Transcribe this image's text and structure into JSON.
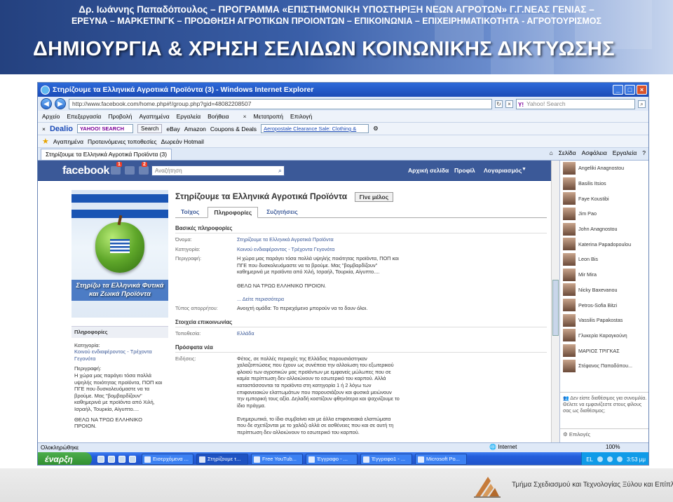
{
  "slide": {
    "header_line1": "Δρ. Ιωάννης Παπαδόπουλος – ΠΡΟΓΡΑΜΜΑ «ΕΠΙΣΤΗΜΟΝΙΚΗ ΥΠΟΣΤΗΡΙΞΗ ΝΕΩΝ ΑΓΡΟΤΩΝ» Γ.Γ.ΝΕΑΣ ΓΕΝΙΑΣ –",
    "header_line2": "ΕΡΕΥΝΑ – ΜΑΡΚΕΤΙΝΓΚ – ΠΡΟΩΘΗΣΗ ΑΓΡΟΤΙΚΩΝ ΠΡΟΙΟΝΤΩΝ – ΕΠΙΚΟΙΝΩΝΙΑ – ΕΠΙΧΕΙΡΗΜΑΤΙΚΟΤΗΤΑ - ΑΓΡΟΤΟΥΡΙΣΜΟΣ",
    "title": "ΔΗΜΙΟΥΡΓΙΑ & ΧΡΗΣΗ ΣΕΛΙΔΩΝ ΚΟΙΝΩΝΙΚΗΣ ΔΙΚΤΥΩΣΗΣ",
    "footer": "Τμήμα Σχεδιασμού και Τεχνολογίας Ξύλου και Επίπλου"
  },
  "browser": {
    "window_title": "Στηρίζουμε τα Ελληνικά Αγροτικά Προϊόντα (3) - Windows Internet Explorer",
    "url": "http://www.facebook.com/home.php#!/group.php?gid=48082208507",
    "search_placeholder": "Yahoo! Search",
    "menu": [
      "Αρχείο",
      "Επεξεργασία",
      "Προβολή",
      "Αγαπημένα",
      "Εργαλεία",
      "Βοήθεια"
    ],
    "menu_extra": [
      "Μετατροπή",
      "Επιλογή"
    ],
    "toolbar": {
      "dealio": "Dealio",
      "yahoo": "YAHOO! SEARCH",
      "search_btn": "Search",
      "ebay": "eBay",
      "amazon": "Amazon",
      "coupons": "Coupons & Deals",
      "ad": "Aeropostale Clearance Sale: Clothing &"
    },
    "favorites": {
      "label": "Αγαπημένα",
      "suggested": "Προτεινόμενες τοποθεσίες",
      "hotmail": "Δωρεάν Hotmail"
    },
    "tab": "Στηρίζουμε τα Ελληνικά Αγροτικά Προϊόντα (3)",
    "commands": [
      "Σελίδα",
      "Ασφάλεια",
      "Εργαλεία"
    ],
    "status_left": "Ολοκληρώθηκε",
    "status_zone": "Internet",
    "status_zoom": "100%"
  },
  "facebook": {
    "logo": "facebook",
    "badge_1": "1",
    "badge_2": "2",
    "search_placeholder": "Αναζήτηση",
    "nav": [
      "Αρχική σελίδα",
      "Προφίλ",
      "Λογαριασμός"
    ],
    "group_name": "Στηρίζουμε τα Ελληνικά Αγροτικά Προϊόντα",
    "join_btn": "Γίνε μέλος",
    "tabs": [
      "Τοίχος",
      "Πληροφορίες",
      "Συζητήσεις"
    ],
    "profile_caption": "Στηρίζω τα Ελληνικά Φυτικά και Ζωικά Προϊόντα",
    "left": {
      "header": "Πληροφορίες",
      "category_label": "Κατηγορία:",
      "category_value": "Κοινού ενδιαφέροντος - Τρέχοντα Γεγονότα",
      "description_label": "Περιγραφή:",
      "description": "Η χώρα μας παράγει τόσα πολλά υψηλής ποιότητας προϊόντα, ΠΟΠ και ΠΓΕ που δυσκολευόμαστε να τα βρούμε. Μας \"βομβαρδίζουν\" καθημερινά με προϊόντα από Χιλή, Ισραήλ, Τουρκία, Αίγυπτο....",
      "closing": "ΘΕΛΩ ΝΑ ΤΡΩΩ ΕΛΛΗΝΙΚΟ ΠΡΟΙΟΝ."
    },
    "basic": {
      "header": "Βασικές πληροφορίες",
      "name_label": "Όνομα:",
      "name_value": "Στηρίζουμε τα Ελληνικά Αγροτικά Προϊόντα",
      "category_label": "Κατηγορία:",
      "category_value": "Κοινού ενδιαφέροντος - Τρέχοντα Γεγονότα",
      "description_label": "Περιγραφή:",
      "description_value": "Η χώρα μας παράγει τόσα πολλά υψηλής ποιότητας προϊόντα, ΠΟΠ και ΠΓΕ που δυσκολευόμαστε να τα βρούμε. Μας \"βομβαρδίζουν\" καθημερινά με προϊόντα από Χιλή, Ισραήλ, Τουρκία, Αίγυπτο....",
      "closing": "ΘΕΛΩ ΝΑ ΤΡΩΩ ΕΛΛΗΝΙΚΟ ΠΡΟΙΟΝ.",
      "see_more": "... Δείτε περισσότερα",
      "privacy_label": "Τύπος απορρήτου:",
      "privacy_value": "Ανοιχτή ομάδα: Το περιεχόμενο μπορούν να το δουν όλοι."
    },
    "contact": {
      "header": "Στοιχεία επικοινωνίας",
      "location_label": "Τοποθεσία:",
      "location_value": "Ελλάδα"
    },
    "news": {
      "header": "Πρόσφατα νέα",
      "label": "Ειδήσεις:",
      "para1": "Φέτος, σε πολλές περιοχές της Ελλάδος παρουσιάστηκαν χαλαζοπτώσεις που έχουν ως συνέπεια την αλλοίωση του εξωτερικού φλοιού των αγροτικών μας προϊόντων με εμφανείς μώλωπες που σε καμία περίπτωση δεν αλλοιώνουν το εσωτερικό του καρπού. Αλλά καταστάσσονται τα προϊόντα στη κατηγορία 1 ή 2 λόγω των επιφανειακών ελαττωμάτων που παρουσιάζουν και φυσικά μειώνουν την εμπορική τους αξία. Δηλαδή κοστίζουν φθηνότερα και ψαχνίζουμε το ίδιο πράγμα.",
      "para2": "Ενημερωτικά, το ίδιο συμβαίνει και με άλλα επιφανειακά ελαττώματα που δε σχετίζονται με το χαλάζι αλλά σε ασθένειες που και σε αυτή τη περίπτωση δεν αλλοιώνουν το εσωτερικό του καρπού."
    },
    "chat": [
      "Angeliki Anagnostou",
      "Basilis Itsios",
      "Faye Koustibi",
      "Jim Pao",
      "John Anagnostou",
      "Katerina Papadopoulou",
      "Leon Bis",
      "Mir Mira",
      "Nicky Baxevanou",
      "Petros-Sofia Bitzi",
      "Vassilis Papakostas",
      "Γλυκερία Καραγκούνη",
      "ΜΑΡΙΟΣ ΤΡΙΓΚΑΣ",
      "Στέφανος Παπαδόπου..."
    ],
    "chat_footer": "Δεν είστε διαθέσιμος για συνομιλία. Θέλετε να εμφανίζεστε στους φίλους σας ως διαθέσιμος;",
    "chat_options": "Επιλογές"
  },
  "taskbar": {
    "start": "έναρξη",
    "tasks": [
      "Εισερχόμενα ...",
      "Στηρίζουμε τ...",
      "Free YouTub...",
      "Έγγραφο - ...",
      "Έγγραφο1 - ...",
      "Microsoft Po..."
    ],
    "lang": "EL",
    "clock": "3:53 μμ"
  }
}
